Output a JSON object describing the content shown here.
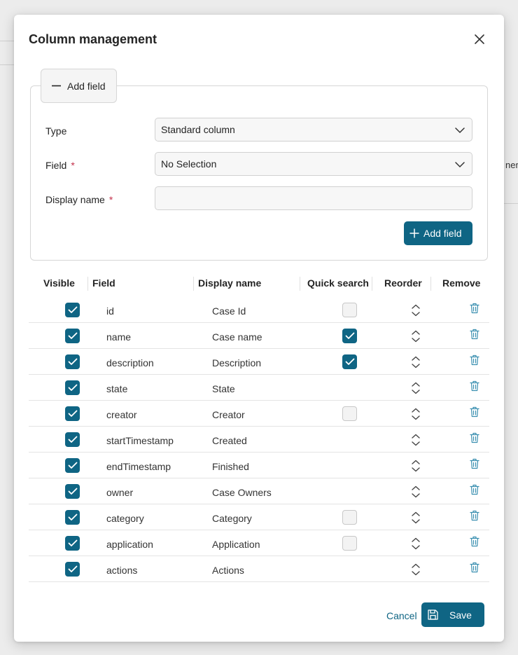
{
  "background": {
    "partial_text": "ners"
  },
  "dialog": {
    "title": "Column management",
    "toggle_label": "Add field",
    "form": {
      "type_label": "Type",
      "type_value": "Standard column",
      "field_label": "Field",
      "field_value": "No Selection",
      "display_name_label": "Display name",
      "display_name_value": "",
      "required_marker": "*",
      "add_button_label": "Add field"
    },
    "table": {
      "headers": {
        "visible": "Visible",
        "field": "Field",
        "display_name": "Display name",
        "quick_search": "Quick search",
        "reorder": "Reorder",
        "remove": "Remove"
      },
      "rows": [
        {
          "field": "id",
          "display_name": "Case Id",
          "visible": true,
          "quick_search": "unchecked"
        },
        {
          "field": "name",
          "display_name": "Case name",
          "visible": true,
          "quick_search": "checked"
        },
        {
          "field": "description",
          "display_name": "Description",
          "visible": true,
          "quick_search": "checked"
        },
        {
          "field": "state",
          "display_name": "State",
          "visible": true,
          "quick_search": "none"
        },
        {
          "field": "creator",
          "display_name": "Creator",
          "visible": true,
          "quick_search": "unchecked"
        },
        {
          "field": "startTimestamp",
          "display_name": "Created",
          "visible": true,
          "quick_search": "none"
        },
        {
          "field": "endTimestamp",
          "display_name": "Finished",
          "visible": true,
          "quick_search": "none"
        },
        {
          "field": "owner",
          "display_name": "Case Owners",
          "visible": true,
          "quick_search": "none"
        },
        {
          "field": "category",
          "display_name": "Category",
          "visible": true,
          "quick_search": "unchecked"
        },
        {
          "field": "application",
          "display_name": "Application",
          "visible": true,
          "quick_search": "unchecked"
        },
        {
          "field": "actions",
          "display_name": "Actions",
          "visible": true,
          "quick_search": "none"
        }
      ]
    },
    "footer": {
      "cancel_label": "Cancel",
      "save_label": "Save"
    }
  },
  "icons": {
    "close": "close-icon",
    "collapse": "minus-icon",
    "dropdown": "chevron-down-icon",
    "add": "plus-icon",
    "check": "check-icon",
    "reorder": "sort-arrows-icon",
    "remove": "trash-icon",
    "save": "floppy-disk-icon"
  },
  "colors": {
    "primary": "#0f6584",
    "required": "#c4314b",
    "trash": "#3a8fb0"
  }
}
